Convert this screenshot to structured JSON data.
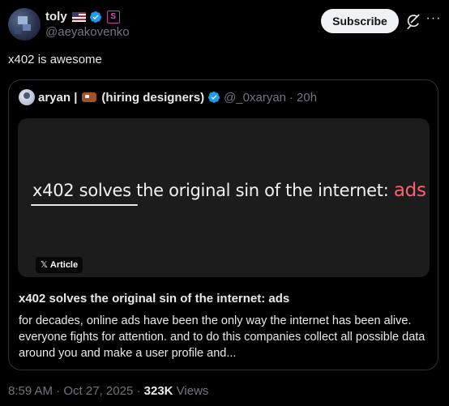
{
  "author": {
    "name": "toly",
    "handle": "@aeyakovenko",
    "badge_letter": "S"
  },
  "subscribe_label": "Subscribe",
  "more_label": "···",
  "tweet_text": "x402 is awesome",
  "quote": {
    "name": "aryan |",
    "name_suffix": "(hiring designers)",
    "handle": "@_0xaryan",
    "separator": "·",
    "time": "20h",
    "banner_text": "x402 solves the original sin of the internet:",
    "banner_accent": "ads",
    "badge_x": "𝕏",
    "badge_label": "Article",
    "title": "x402 solves the original sin of the internet: ads",
    "description": "for decades, online ads have been the only way the internet has been alive. everyone fights for attention. and to do this companies collect all possible data around you and make a user profile and..."
  },
  "meta": {
    "time": "8:59 AM",
    "separator": "·",
    "date": "Oct 27, 2025",
    "views_count": "323K",
    "views_label": "Views"
  },
  "colors": {
    "background": "#000000",
    "accent_blue": "#1d9bf0",
    "muted": "#71767b",
    "ads_red": "#ff5f6e"
  }
}
